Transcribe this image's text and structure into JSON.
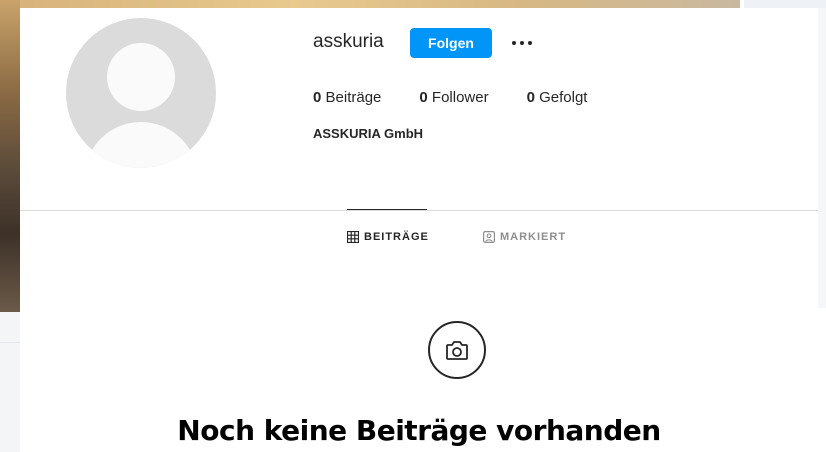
{
  "profile": {
    "username": "asskuria",
    "follow_label": "Folgen",
    "more_icon": "more-horizontal-icon",
    "full_name": "ASSKURIA GmbH",
    "stats": [
      {
        "count": "0",
        "label": "Beiträge"
      },
      {
        "count": "0",
        "label": "Follower"
      },
      {
        "count": "0",
        "label": "Gefolgt"
      }
    ]
  },
  "tabs": [
    {
      "label": "BEITRÄGE",
      "icon": "grid-icon",
      "active": true
    },
    {
      "label": "MARKIERT",
      "icon": "tagged-user-icon",
      "active": false
    }
  ],
  "empty_state": {
    "icon": "camera-icon",
    "title": "Noch keine Beiträge vorhanden"
  },
  "colors": {
    "accent": "#0095f6",
    "text": "#262626",
    "muted": "#8e8e8e",
    "divider": "#dbdbdb",
    "avatar_bg": "#dbdbdb"
  }
}
